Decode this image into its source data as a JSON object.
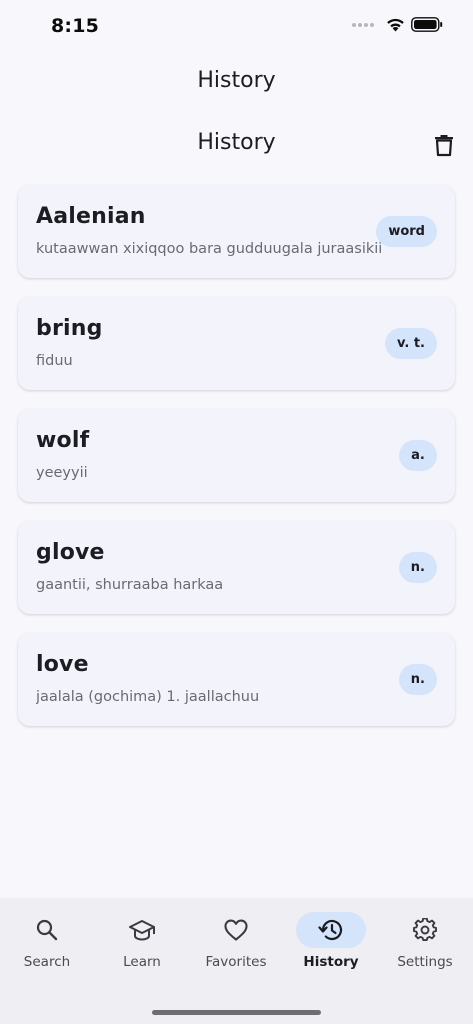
{
  "status_bar": {
    "time": "8:15"
  },
  "app_bar": {
    "title": "History"
  },
  "section": {
    "title": "History",
    "clear_icon": "trash-icon"
  },
  "history": [
    {
      "word": "Aalenian",
      "meaning": "kutaawwan xixiqqoo bara gudduugala juraasikii",
      "pos": "word"
    },
    {
      "word": "bring",
      "meaning": "fiduu",
      "pos": "v. t."
    },
    {
      "word": "wolf",
      "meaning": "yeeyyii",
      "pos": "a."
    },
    {
      "word": "glove",
      "meaning": "gaantii, shurraaba harkaa",
      "pos": "n."
    },
    {
      "word": "love",
      "meaning": "jaalala (gochima)  1.  jaallachuu",
      "pos": "n."
    }
  ],
  "nav": {
    "search": "Search",
    "learn": "Learn",
    "favorites": "Favorites",
    "history": "History",
    "settings": "Settings",
    "active": "history"
  },
  "colors": {
    "accent_bg": "#d3e4fb",
    "background": "#f8f8fc",
    "card": "#f3f4fb",
    "nav_bg": "#eeeef3"
  }
}
